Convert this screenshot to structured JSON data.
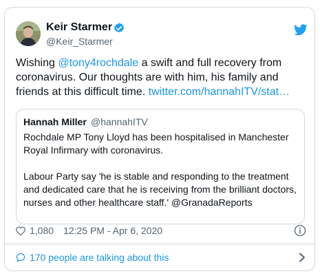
{
  "author": {
    "name": "Keir Starmer",
    "handle": "@Keir_Starmer"
  },
  "tweet": {
    "text_prefix": "Wishing ",
    "mention": "@tony4rochdale",
    "text_body": " a swift and full recovery from coronavirus. Our thoughts are with him, his family and friends at this difficult time. ",
    "link": "twitter.com/hannahITV/stat…"
  },
  "quote": {
    "name": "Hannah Miller",
    "handle": "@hannahITV",
    "paragraph1": "Rochdale MP Tony Lloyd has been hospitalised in Manchester Royal Infirmary with coronavirus.",
    "paragraph2": "Labour Party say 'he is stable and responding to the treatment and dedicated care that he is receiving from the brilliant doctors, nurses and other healthcare staff.' @GranadaReports"
  },
  "footer": {
    "likes": "1,080",
    "timestamp": "12:25 PM - Apr 6, 2020"
  },
  "conversation": {
    "label": "170 people are talking about this"
  },
  "colors": {
    "link": "#1b95e0",
    "border": "#cfd9de",
    "muted": "#536471",
    "verified": "#1da1f2"
  },
  "icons": {
    "verified": "verified-badge-icon",
    "brand": "twitter-bird-icon",
    "like": "heart-icon",
    "info": "info-icon",
    "reply": "speech-bubble-icon",
    "more": "chevron-right-icon"
  }
}
